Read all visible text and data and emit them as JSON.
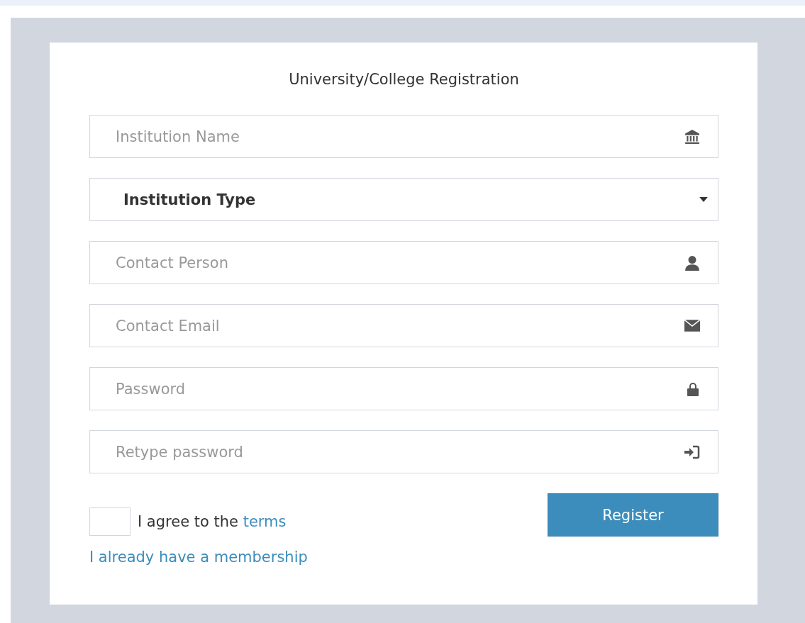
{
  "title": "University/College Registration",
  "fields": [
    {
      "kind": "text",
      "placeholder": "Institution Name"
    },
    {
      "kind": "select",
      "value": "Institution Type"
    },
    {
      "kind": "text",
      "placeholder": "Contact Person"
    },
    {
      "kind": "text",
      "placeholder": "Contact Email"
    },
    {
      "kind": "password",
      "placeholder": "Password"
    },
    {
      "kind": "password",
      "placeholder": "Retype password"
    }
  ],
  "agree": {
    "checked": false,
    "text": "I agree to the ",
    "link": "terms"
  },
  "register_button": "Register",
  "membership_link": "I already have a membership"
}
